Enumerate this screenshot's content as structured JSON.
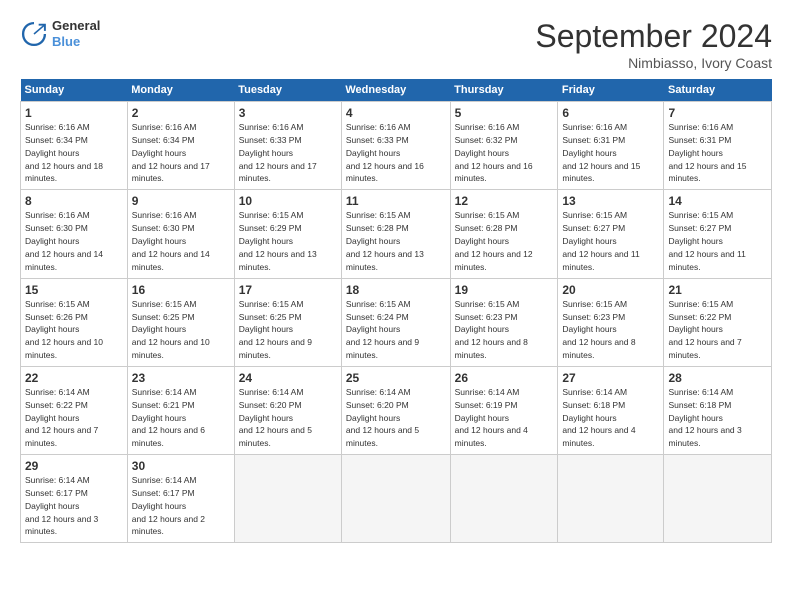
{
  "header": {
    "logo_line1": "General",
    "logo_line2": "Blue",
    "month_title": "September 2024",
    "subtitle": "Nimbiasso, Ivory Coast"
  },
  "weekdays": [
    "Sunday",
    "Monday",
    "Tuesday",
    "Wednesday",
    "Thursday",
    "Friday",
    "Saturday"
  ],
  "weeks": [
    [
      {
        "day": "1",
        "sunrise": "6:16 AM",
        "sunset": "6:34 PM",
        "daylight": "12 hours and 18 minutes."
      },
      {
        "day": "2",
        "sunrise": "6:16 AM",
        "sunset": "6:34 PM",
        "daylight": "12 hours and 17 minutes."
      },
      {
        "day": "3",
        "sunrise": "6:16 AM",
        "sunset": "6:33 PM",
        "daylight": "12 hours and 17 minutes."
      },
      {
        "day": "4",
        "sunrise": "6:16 AM",
        "sunset": "6:33 PM",
        "daylight": "12 hours and 16 minutes."
      },
      {
        "day": "5",
        "sunrise": "6:16 AM",
        "sunset": "6:32 PM",
        "daylight": "12 hours and 16 minutes."
      },
      {
        "day": "6",
        "sunrise": "6:16 AM",
        "sunset": "6:31 PM",
        "daylight": "12 hours and 15 minutes."
      },
      {
        "day": "7",
        "sunrise": "6:16 AM",
        "sunset": "6:31 PM",
        "daylight": "12 hours and 15 minutes."
      }
    ],
    [
      {
        "day": "8",
        "sunrise": "6:16 AM",
        "sunset": "6:30 PM",
        "daylight": "12 hours and 14 minutes."
      },
      {
        "day": "9",
        "sunrise": "6:16 AM",
        "sunset": "6:30 PM",
        "daylight": "12 hours and 14 minutes."
      },
      {
        "day": "10",
        "sunrise": "6:15 AM",
        "sunset": "6:29 PM",
        "daylight": "12 hours and 13 minutes."
      },
      {
        "day": "11",
        "sunrise": "6:15 AM",
        "sunset": "6:28 PM",
        "daylight": "12 hours and 13 minutes."
      },
      {
        "day": "12",
        "sunrise": "6:15 AM",
        "sunset": "6:28 PM",
        "daylight": "12 hours and 12 minutes."
      },
      {
        "day": "13",
        "sunrise": "6:15 AM",
        "sunset": "6:27 PM",
        "daylight": "12 hours and 11 minutes."
      },
      {
        "day": "14",
        "sunrise": "6:15 AM",
        "sunset": "6:27 PM",
        "daylight": "12 hours and 11 minutes."
      }
    ],
    [
      {
        "day": "15",
        "sunrise": "6:15 AM",
        "sunset": "6:26 PM",
        "daylight": "12 hours and 10 minutes."
      },
      {
        "day": "16",
        "sunrise": "6:15 AM",
        "sunset": "6:25 PM",
        "daylight": "12 hours and 10 minutes."
      },
      {
        "day": "17",
        "sunrise": "6:15 AM",
        "sunset": "6:25 PM",
        "daylight": "12 hours and 9 minutes."
      },
      {
        "day": "18",
        "sunrise": "6:15 AM",
        "sunset": "6:24 PM",
        "daylight": "12 hours and 9 minutes."
      },
      {
        "day": "19",
        "sunrise": "6:15 AM",
        "sunset": "6:23 PM",
        "daylight": "12 hours and 8 minutes."
      },
      {
        "day": "20",
        "sunrise": "6:15 AM",
        "sunset": "6:23 PM",
        "daylight": "12 hours and 8 minutes."
      },
      {
        "day": "21",
        "sunrise": "6:15 AM",
        "sunset": "6:22 PM",
        "daylight": "12 hours and 7 minutes."
      }
    ],
    [
      {
        "day": "22",
        "sunrise": "6:14 AM",
        "sunset": "6:22 PM",
        "daylight": "12 hours and 7 minutes."
      },
      {
        "day": "23",
        "sunrise": "6:14 AM",
        "sunset": "6:21 PM",
        "daylight": "12 hours and 6 minutes."
      },
      {
        "day": "24",
        "sunrise": "6:14 AM",
        "sunset": "6:20 PM",
        "daylight": "12 hours and 5 minutes."
      },
      {
        "day": "25",
        "sunrise": "6:14 AM",
        "sunset": "6:20 PM",
        "daylight": "12 hours and 5 minutes."
      },
      {
        "day": "26",
        "sunrise": "6:14 AM",
        "sunset": "6:19 PM",
        "daylight": "12 hours and 4 minutes."
      },
      {
        "day": "27",
        "sunrise": "6:14 AM",
        "sunset": "6:18 PM",
        "daylight": "12 hours and 4 minutes."
      },
      {
        "day": "28",
        "sunrise": "6:14 AM",
        "sunset": "6:18 PM",
        "daylight": "12 hours and 3 minutes."
      }
    ],
    [
      {
        "day": "29",
        "sunrise": "6:14 AM",
        "sunset": "6:17 PM",
        "daylight": "12 hours and 3 minutes."
      },
      {
        "day": "30",
        "sunrise": "6:14 AM",
        "sunset": "6:17 PM",
        "daylight": "12 hours and 2 minutes."
      },
      null,
      null,
      null,
      null,
      null
    ]
  ]
}
